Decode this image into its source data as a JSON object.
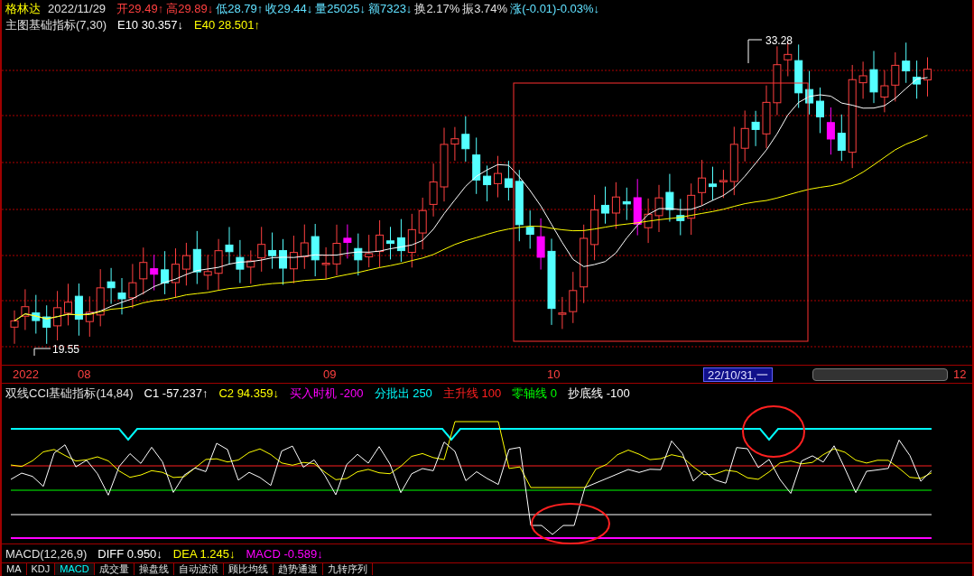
{
  "header": {
    "stock_name": "格林达",
    "date": "2022/11/29",
    "quotes": [
      {
        "text": "开29.49↑",
        "color": "#ff4040"
      },
      {
        "text": "高29.89↓",
        "color": "#ff4040"
      },
      {
        "text": "低28.79↑",
        "color": "#60e0ff"
      },
      {
        "text": "收29.44↓",
        "color": "#60e0ff"
      },
      {
        "text": "量25025↓",
        "color": "#60e0ff"
      },
      {
        "text": "额7323↓",
        "color": "#60e0ff"
      },
      {
        "text": "换2.17%",
        "color": "#e0e0e0"
      },
      {
        "text": "振3.74%",
        "color": "#e0e0e0"
      },
      {
        "text": "涨(-0.01)-0.03%↓",
        "color": "#60e0ff"
      }
    ]
  },
  "main_indicator": {
    "name": "主图基础指标(7,30)",
    "values": [
      {
        "text": "E10 30.357↓",
        "color": "#ffffff"
      },
      {
        "text": "E40 28.501↑",
        "color": "#ffff00"
      }
    ]
  },
  "chart_labels": {
    "high": "33.28",
    "low": "19.55"
  },
  "x_axis": {
    "labels": [
      "2022",
      "08",
      "09",
      "10",
      "12"
    ],
    "cursor_date": "22/10/31,一"
  },
  "cci": {
    "name": "双线CCI基础指标(14,84)",
    "values": [
      {
        "text": "C1 -57.237↑",
        "color": "#ffffff"
      },
      {
        "text": "C2 94.359↓",
        "color": "#ffff00"
      },
      {
        "text": "买入时机 -200",
        "color": "#ff00ff"
      },
      {
        "text": "分批出 250",
        "color": "#00ffff"
      },
      {
        "text": "主升线 100",
        "color": "#ff2020"
      },
      {
        "text": "零轴线 0",
        "color": "#00ff00"
      },
      {
        "text": "抄底线 -100",
        "color": "#ffffff"
      }
    ]
  },
  "macd": {
    "name": "MACD(12,26,9)",
    "values": [
      {
        "text": "DIFF 0.950↓",
        "color": "#ffffff"
      },
      {
        "text": "DEA 1.245↓",
        "color": "#ffff00"
      },
      {
        "text": "MACD -0.589↓",
        "color": "#ff00ff"
      }
    ]
  },
  "tabs": [
    {
      "label": "MA",
      "selected": false
    },
    {
      "label": "KDJ",
      "selected": false
    },
    {
      "label": "MACD",
      "selected": true
    },
    {
      "label": "成交量",
      "selected": false
    },
    {
      "label": "操盘线",
      "selected": false
    },
    {
      "label": "自动波浪",
      "selected": false
    },
    {
      "label": "顾比均线",
      "selected": false
    },
    {
      "label": "趋势通道",
      "selected": false
    },
    {
      "label": "九转序列",
      "selected": false
    }
  ]
}
